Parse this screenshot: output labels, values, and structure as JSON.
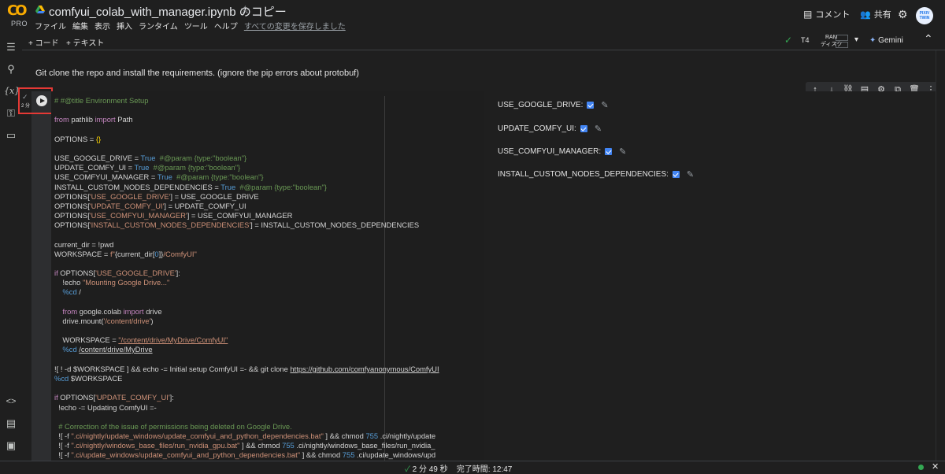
{
  "app": {
    "logo_text": "CO",
    "logo_badge": "PRO",
    "notebook_title": "comfyui_colab_with_manager.ipynb のコピー",
    "star_icon": "star-outline-icon"
  },
  "menu": {
    "items": [
      "ファイル",
      "編集",
      "表示",
      "挿入",
      "ランタイム",
      "ツール",
      "ヘルプ"
    ],
    "saved_status": "すべての変更を保存しました"
  },
  "header_right": {
    "comment_label": "コメント",
    "share_label": "共有",
    "avatar_text": "PIXIV TWIN"
  },
  "toolbar": {
    "add_code": "+ コード",
    "add_text": "+ テキスト",
    "runtime_type": "T4",
    "ram_label": "RAM",
    "disk_label": "ディスク",
    "gemini_label": "Gemini"
  },
  "markdown_cell": {
    "text": "Git clone the repo and install the requirements. (ignore the pip errors about protobuf)"
  },
  "code_cell": {
    "exec_time": "2 分"
  },
  "form_fields": [
    {
      "label": "USE_GOOGLE_DRIVE:",
      "checked": true
    },
    {
      "label": "UPDATE_COMFY_UI:",
      "checked": true
    },
    {
      "label": "USE_COMFYUI_MANAGER:",
      "checked": true
    },
    {
      "label": "INSTALL_CUSTOM_NODES_DEPENDENCIES:",
      "checked": true
    }
  ],
  "status_bar": {
    "elapsed": "2 分 49 秒",
    "completed": "完了時間: 12:47"
  },
  "colors": {
    "accent_checkbox": "#4285f4",
    "highlight_border": "#e53935",
    "status_ok": "#34a853",
    "gemini_star": "#8ab4f8"
  }
}
